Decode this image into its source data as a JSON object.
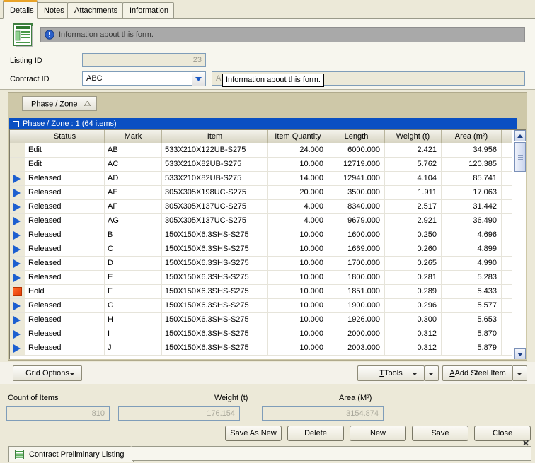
{
  "tabs": [
    {
      "label": "Details",
      "active": true
    },
    {
      "label": "Notes",
      "active": false
    },
    {
      "label": "Attachments",
      "active": false
    },
    {
      "label": "Information",
      "active": false
    }
  ],
  "form": {
    "info_bar_text": "Information about this form.",
    "tooltip_text": "Information about this form.",
    "listing_id_label": "Listing ID",
    "listing_id_value": "23",
    "contract_id_label": "Contract ID",
    "contract_id_value": "ABC",
    "contract_desc_placeholder": "ABC",
    "form_icon": "form-document-icon",
    "info_icon": "info-circle-icon"
  },
  "grid": {
    "group_chip_label": "Phase / Zone",
    "group_chip_sort": "ascending-sort-icon",
    "group_row_label": "Phase / Zone : 1 (64 items)",
    "columns": [
      {
        "key": "status",
        "label": "Status"
      },
      {
        "key": "mark",
        "label": "Mark"
      },
      {
        "key": "item",
        "label": "Item"
      },
      {
        "key": "qty",
        "label": "Item Quantity"
      },
      {
        "key": "length",
        "label": "Length"
      },
      {
        "key": "weight",
        "label": "Weight (t)"
      },
      {
        "key": "area",
        "label": "Area (m²)"
      }
    ],
    "rows": [
      {
        "indicator": "none",
        "status": "Edit",
        "mark": "AB",
        "item": "533X210X122UB-S275",
        "qty": "24.000",
        "length": "6000.000",
        "weight": "2.421",
        "area": "34.956"
      },
      {
        "indicator": "none",
        "status": "Edit",
        "mark": "AC",
        "item": "533X210X82UB-S275",
        "qty": "10.000",
        "length": "12719.000",
        "weight": "5.762",
        "area": "120.385"
      },
      {
        "indicator": "released",
        "status": "Released",
        "mark": "AD",
        "item": "533X210X82UB-S275",
        "qty": "14.000",
        "length": "12941.000",
        "weight": "4.104",
        "area": "85.741"
      },
      {
        "indicator": "released",
        "status": "Released",
        "mark": "AE",
        "item": "305X305X198UC-S275",
        "qty": "20.000",
        "length": "3500.000",
        "weight": "1.911",
        "area": "17.063"
      },
      {
        "indicator": "released",
        "status": "Released",
        "mark": "AF",
        "item": "305X305X137UC-S275",
        "qty": "4.000",
        "length": "8340.000",
        "weight": "2.517",
        "area": "31.442"
      },
      {
        "indicator": "released",
        "status": "Released",
        "mark": "AG",
        "item": "305X305X137UC-S275",
        "qty": "4.000",
        "length": "9679.000",
        "weight": "2.921",
        "area": "36.490"
      },
      {
        "indicator": "released",
        "status": "Released",
        "mark": "B",
        "item": "150X150X6.3SHS-S275",
        "qty": "10.000",
        "length": "1600.000",
        "weight": "0.250",
        "area": "4.696"
      },
      {
        "indicator": "released",
        "status": "Released",
        "mark": "C",
        "item": "150X150X6.3SHS-S275",
        "qty": "10.000",
        "length": "1669.000",
        "weight": "0.260",
        "area": "4.899"
      },
      {
        "indicator": "released",
        "status": "Released",
        "mark": "D",
        "item": "150X150X6.3SHS-S275",
        "qty": "10.000",
        "length": "1700.000",
        "weight": "0.265",
        "area": "4.990"
      },
      {
        "indicator": "released",
        "status": "Released",
        "mark": "E",
        "item": "150X150X6.3SHS-S275",
        "qty": "10.000",
        "length": "1800.000",
        "weight": "0.281",
        "area": "5.283"
      },
      {
        "indicator": "hold",
        "status": "Hold",
        "mark": "F",
        "item": "150X150X6.3SHS-S275",
        "qty": "10.000",
        "length": "1851.000",
        "weight": "0.289",
        "area": "5.433"
      },
      {
        "indicator": "released",
        "status": "Released",
        "mark": "G",
        "item": "150X150X6.3SHS-S275",
        "qty": "10.000",
        "length": "1900.000",
        "weight": "0.296",
        "area": "5.577"
      },
      {
        "indicator": "released",
        "status": "Released",
        "mark": "H",
        "item": "150X150X6.3SHS-S275",
        "qty": "10.000",
        "length": "1926.000",
        "weight": "0.300",
        "area": "5.653"
      },
      {
        "indicator": "released",
        "status": "Released",
        "mark": "I",
        "item": "150X150X6.3SHS-S275",
        "qty": "10.000",
        "length": "2000.000",
        "weight": "0.312",
        "area": "5.870"
      },
      {
        "indicator": "released",
        "status": "Released",
        "mark": "J",
        "item": "150X150X6.3SHS-S275",
        "qty": "10.000",
        "length": "2003.000",
        "weight": "0.312",
        "area": "5.879"
      }
    ],
    "scroll_up_icon": "chevron-up-icon",
    "scroll_down_icon": "chevron-down-icon"
  },
  "gridtoolbar": {
    "grid_options_label": "Grid Options",
    "tools_label": "Tools",
    "add_steel_item_label": "Add Steel Item"
  },
  "summary": {
    "count_label": "Count of Items",
    "count_value": "810",
    "weight_label": "Weight (t)",
    "weight_value": "176.154",
    "area_label": "Area (M²)",
    "area_value": "3154.874"
  },
  "actions": [
    {
      "label": "Save As New"
    },
    {
      "label": "Delete"
    },
    {
      "label": "New"
    },
    {
      "label": "Save"
    },
    {
      "label": "Close"
    }
  ],
  "statusbar": {
    "tab_label": "Contract Preliminary Listing",
    "tab_icon": "document-list-icon",
    "close_glyph": "✕"
  },
  "colors": {
    "accent_tab": "#e9a327",
    "group_row": "#0a4fc2",
    "released_indicator": "#1d5fd0",
    "hold_indicator": "#e43b06",
    "panel": "#ece9d8"
  }
}
